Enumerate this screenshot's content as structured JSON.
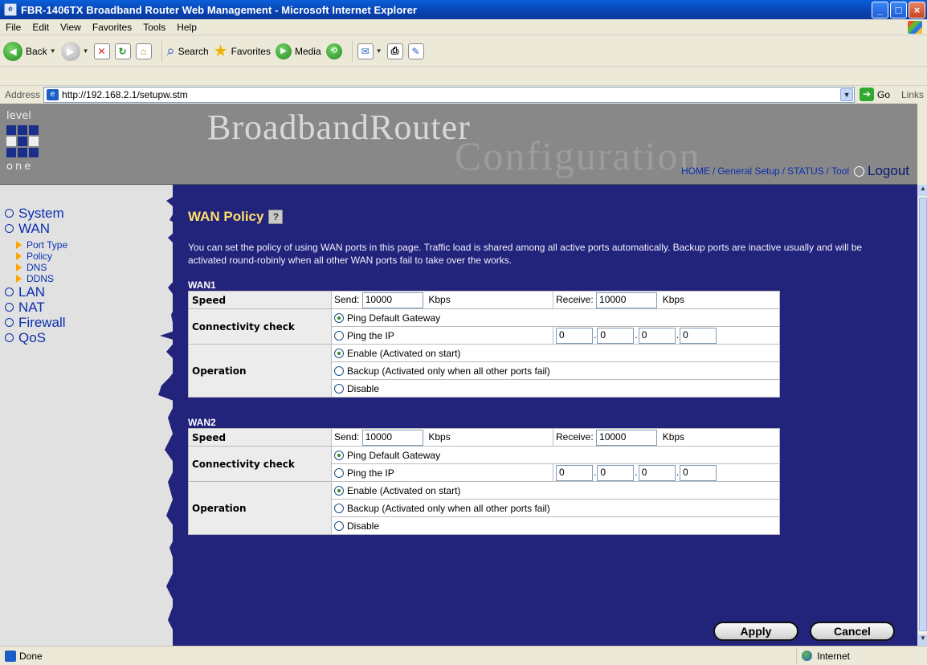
{
  "window": {
    "title": "FBR-1406TX Broadband Router Web Management - Microsoft Internet Explorer"
  },
  "menu": [
    "File",
    "Edit",
    "View",
    "Favorites",
    "Tools",
    "Help"
  ],
  "toolbar": {
    "back": "Back",
    "search": "Search",
    "favorites": "Favorites",
    "media": "Media"
  },
  "address": {
    "label": "Address",
    "url": "http://192.168.2.1/setupw.stm",
    "go": "Go",
    "links": "Links"
  },
  "header": {
    "logo_top": "level",
    "logo_bottom": "one",
    "brand1": "BroadbandRouter",
    "brand2": "Configuration",
    "nav": [
      "HOME",
      "General Setup",
      "STATUS",
      "Tool"
    ],
    "logout": "Logout"
  },
  "sidebar": {
    "items": [
      "System",
      "WAN",
      "LAN",
      "NAT",
      "Firewall",
      "QoS"
    ],
    "wan_sub": [
      "Port Type",
      "Policy",
      "DNS",
      "DDNS"
    ]
  },
  "main": {
    "title": "WAN Policy",
    "description": "You can set the policy of using WAN ports in this page. Traffic load is shared among all active ports automatically. Backup ports are inactive usually and will be activated round-robinly when all other WAN ports fail to take over the works.",
    "wan_sections": [
      {
        "label": "WAN1",
        "speed_label": "Speed",
        "send_label": "Send:",
        "send_value": "10000",
        "send_unit": "Kbps",
        "receive_label": "Receive:",
        "receive_value": "10000",
        "receive_unit": "Kbps",
        "conn_label": "Connectivity check",
        "ping_gateway": "Ping Default Gateway",
        "ping_ip": "Ping the IP",
        "ip": [
          "0",
          "0",
          "0",
          "0"
        ],
        "op_label": "Operation",
        "op_enable": "Enable (Activated on start)",
        "op_backup": "Backup (Activated only when all other ports fail)",
        "op_disable": "Disable"
      },
      {
        "label": "WAN2",
        "speed_label": "Speed",
        "send_label": "Send:",
        "send_value": "10000",
        "send_unit": "Kbps",
        "receive_label": "Receive:",
        "receive_value": "10000",
        "receive_unit": "Kbps",
        "conn_label": "Connectivity check",
        "ping_gateway": "Ping Default Gateway",
        "ping_ip": "Ping the IP",
        "ip": [
          "0",
          "0",
          "0",
          "0"
        ],
        "op_label": "Operation",
        "op_enable": "Enable (Activated on start)",
        "op_backup": "Backup (Activated only when all other ports fail)",
        "op_disable": "Disable"
      }
    ],
    "apply": "Apply",
    "cancel": "Cancel"
  },
  "status": {
    "text": "Done",
    "zone": "Internet"
  },
  "colors": {
    "content_bg": "#22237a",
    "title_yellow": "#ffe06a",
    "nav_blue": "#0a2fb0"
  }
}
